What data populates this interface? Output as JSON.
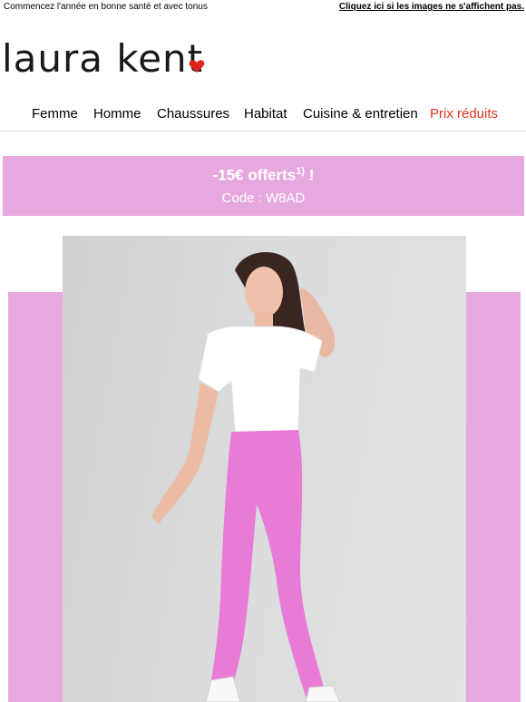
{
  "preheader": {
    "tagline": "Commencez l'année en bonne santé et avec tonus",
    "view_images_link": "Cliquez ici si les images ne s'affichent pas."
  },
  "brand": {
    "name": "laura kent",
    "heart_color": "#e2231a"
  },
  "nav": {
    "items": [
      {
        "label": "Femme"
      },
      {
        "label": "Homme"
      },
      {
        "label": "Chaussures"
      },
      {
        "label": "Habitat"
      },
      {
        "label": "Cuisine & entretien"
      },
      {
        "label": "Prix réduits"
      }
    ],
    "sale_color": "#e2311d"
  },
  "promo": {
    "title": "-15€ offerts",
    "footnote_mark": "1)",
    "exclamation": " !",
    "code_text": "Code : W8AD",
    "background_color": "#e6a8df"
  },
  "hero": {
    "accent_color": "#e6a8df",
    "leggings_color": "#e77bd6",
    "tshirt_color": "#ffffff"
  }
}
